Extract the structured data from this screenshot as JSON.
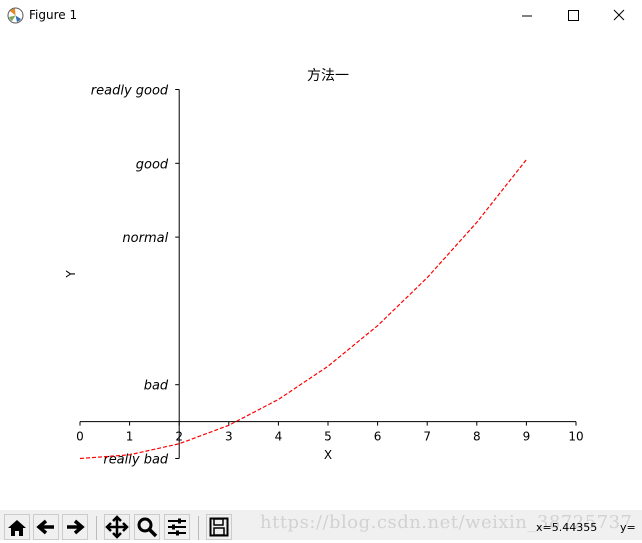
{
  "window": {
    "title": "Figure 1"
  },
  "toolbar": {
    "buttons": [
      "home-icon",
      "back-icon",
      "forward-icon",
      "pan-icon",
      "zoom-icon",
      "configure-subplots-icon",
      "save-icon"
    ],
    "coords_x": "x=5.44355",
    "coords_y": "y=",
    "watermark": "https://blog.csdn.net/weixin_38725737"
  },
  "chart_data": {
    "type": "line",
    "title": "方法一",
    "xlabel": "X",
    "ylabel": "Y",
    "xlim": [
      0,
      10
    ],
    "ylim": [
      0,
      100
    ],
    "xticks": [
      0,
      1,
      2,
      3,
      4,
      5,
      6,
      7,
      8,
      9,
      10
    ],
    "xtick_labels": [
      "0",
      "1",
      "2",
      "3",
      "4",
      "5",
      "6",
      "7",
      "8",
      "9",
      "10"
    ],
    "yticks": [
      0,
      20,
      60,
      80,
      100
    ],
    "ytick_labels": [
      "really bad",
      "bad",
      "normal",
      "good",
      "readly good"
    ],
    "bottom_spine_at_y": 10,
    "left_spine_at_x": 2,
    "grid": false,
    "series": [
      {
        "x": [
          0,
          1,
          2,
          3,
          4,
          5,
          6,
          7,
          8,
          9
        ],
        "y": [
          0,
          1,
          4,
          9,
          16,
          25,
          36,
          49,
          64,
          81
        ],
        "color": "#ff0000",
        "linestyle": "dashed"
      }
    ]
  }
}
